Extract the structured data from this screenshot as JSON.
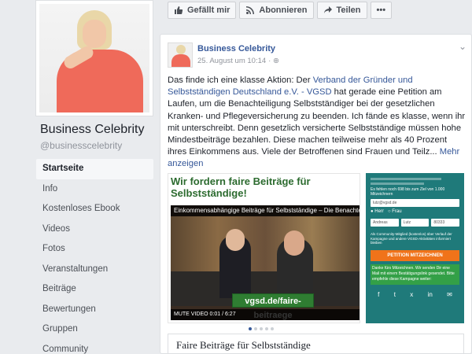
{
  "page": {
    "name": "Business Celebrity",
    "handle": "@businesscelebrity"
  },
  "nav": [
    {
      "label": "Startseite",
      "active": true
    },
    {
      "label": "Info"
    },
    {
      "label": "Kostenloses Ebook"
    },
    {
      "label": "Videos"
    },
    {
      "label": "Fotos"
    },
    {
      "label": "Veranstaltungen"
    },
    {
      "label": "Beiträge"
    },
    {
      "label": "Bewertungen"
    },
    {
      "label": "Gruppen"
    },
    {
      "label": "Community"
    }
  ],
  "topbar": {
    "like": "Gefällt mir",
    "subscribe": "Abonnieren",
    "share": "Teilen",
    "more": "•••"
  },
  "post": {
    "author": "Business Celebrity",
    "timestamp": "25. August um 10:14",
    "text_before": "Das finde ich eine klasse Aktion: Der ",
    "link": "Verband der Gründer und Selbstständigen Deutschland e.V. - VGSD",
    "text_after": " hat gerade eine Petition am Laufen, um die Benachteiligung Selbstständiger bei der gesetzlichen Kranken- und Pflegeversicherung zu beenden. Ich fände es klasse, wenn ihr mit unterschreibt. Denn gesetzlich versicherte Selbstständige müssen hohe Mindestbeiträge bezahlen. Diese machen teilweise mehr als 40 Prozent ihres Einkommens aus. Viele der Betroffenen sind Frauen und Teilz... ",
    "more": "Mehr anzeigen"
  },
  "media": {
    "headline": "Wir fordern faire Beiträge für Selbstständige!",
    "video_title": "Einkommensabhängige Beiträge für Selbstständige – Die Benachteil...",
    "overlay": "vgsd.de/faire-beitraege",
    "video_time": "MUTE VIDEO  0:01 / 6:27",
    "form": {
      "counter": "Es fehlen noch 698 bis zum Ziel von 1.000 Mitzeichnern",
      "email": "lutz@vgsd.de",
      "herr": "Herr",
      "frau": "Frau",
      "first": "Andreas",
      "last": "Lutz",
      "zip": "80333",
      "consent": "Als Community-Mitglied (kostenlos) über Verlauf der Kampagne und andere VGSD-Aktivitäten informiert bleiben",
      "cta": "PETITION MITZEICHNEN",
      "green": "Danke fürs Mitzeichnen. Wir senden Dir eine Mail mit einem Bestätigungslink gesendet. Bitte empfehle diese Kampagne weiter:"
    }
  },
  "caption": "Faire Beiträge für Selbstständige",
  "colors": {
    "link": "#365899",
    "bg": "#e9ebee",
    "accent_green": "#2f7d32",
    "teal": "#1f7a7a",
    "orange": "#f0731a"
  }
}
